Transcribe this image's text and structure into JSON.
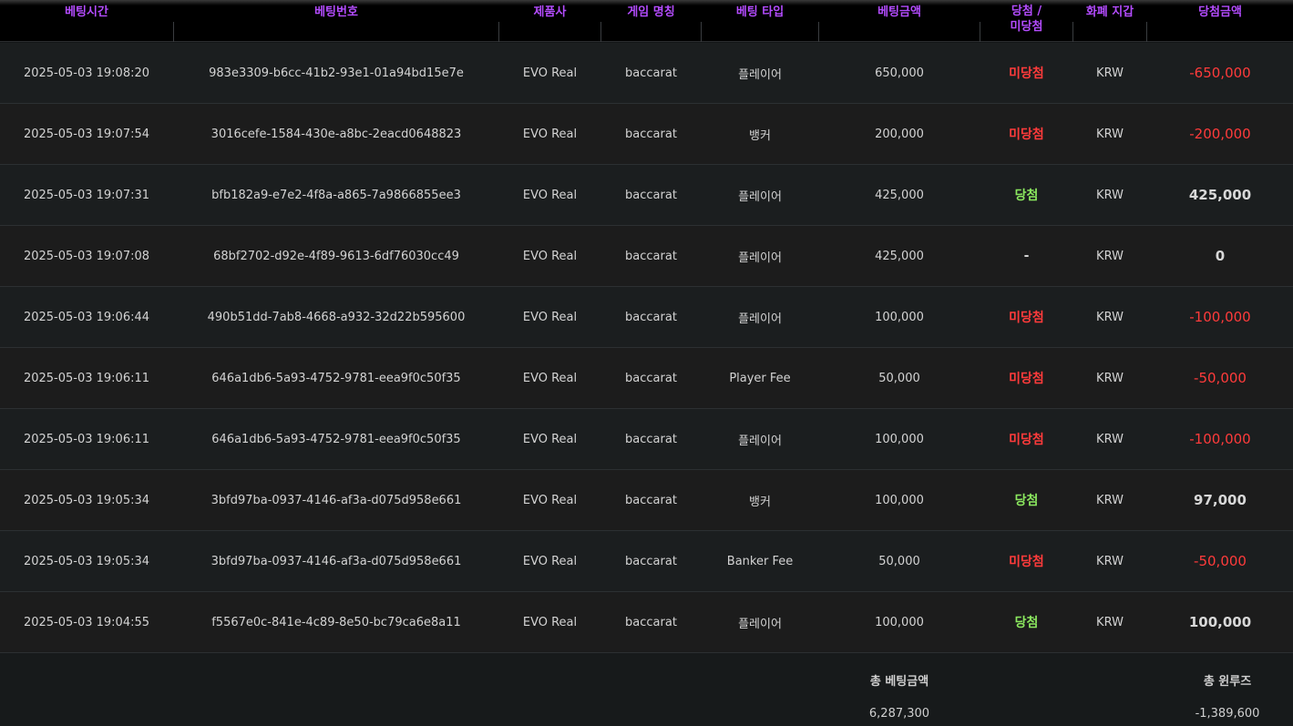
{
  "headers": {
    "time": "베팅시간",
    "bet_id": "베팅번호",
    "provider": "제품사",
    "game": "게임 명칭",
    "bet_type": "베팅 타입",
    "bet_amount": "베팅금액",
    "result_line1": "당첨 /",
    "result_line2": "미당첨",
    "currency": "화폐 지갑",
    "win_amount": "당첨금액"
  },
  "rows": [
    {
      "time": "2025-05-03 19:08:20",
      "bet_id": "983e3309-b6cc-41b2-93e1-01a94bd15e7e",
      "provider": "EVO Real",
      "game": "baccarat",
      "bet_type": "플레이어",
      "bet_amount": "650,000",
      "result": "미당첨",
      "result_kind": "lose",
      "currency": "KRW",
      "win_amount": "-650,000",
      "amount_kind": "lose"
    },
    {
      "time": "2025-05-03 19:07:54",
      "bet_id": "3016cefe-1584-430e-a8bc-2eacd0648823",
      "provider": "EVO Real",
      "game": "baccarat",
      "bet_type": "뱅커",
      "bet_amount": "200,000",
      "result": "미당첨",
      "result_kind": "lose",
      "currency": "KRW",
      "win_amount": "-200,000",
      "amount_kind": "lose"
    },
    {
      "time": "2025-05-03 19:07:31",
      "bet_id": "bfb182a9-e7e2-4f8a-a865-7a9866855ee3",
      "provider": "EVO Real",
      "game": "baccarat",
      "bet_type": "플레이어",
      "bet_amount": "425,000",
      "result": "당첨",
      "result_kind": "win",
      "currency": "KRW",
      "win_amount": "425,000",
      "amount_kind": "win"
    },
    {
      "time": "2025-05-03 19:07:08",
      "bet_id": "68bf2702-d92e-4f89-9613-6df76030cc49",
      "provider": "EVO Real",
      "game": "baccarat",
      "bet_type": "플레이어",
      "bet_amount": "425,000",
      "result": "-",
      "result_kind": "neutral",
      "currency": "KRW",
      "win_amount": "0",
      "amount_kind": "neutral"
    },
    {
      "time": "2025-05-03 19:06:44",
      "bet_id": "490b51dd-7ab8-4668-a932-32d22b595600",
      "provider": "EVO Real",
      "game": "baccarat",
      "bet_type": "플레이어",
      "bet_amount": "100,000",
      "result": "미당첨",
      "result_kind": "lose",
      "currency": "KRW",
      "win_amount": "-100,000",
      "amount_kind": "lose"
    },
    {
      "time": "2025-05-03 19:06:11",
      "bet_id": "646a1db6-5a93-4752-9781-eea9f0c50f35",
      "provider": "EVO Real",
      "game": "baccarat",
      "bet_type": "Player Fee",
      "bet_amount": "50,000",
      "result": "미당첨",
      "result_kind": "lose",
      "currency": "KRW",
      "win_amount": "-50,000",
      "amount_kind": "lose"
    },
    {
      "time": "2025-05-03 19:06:11",
      "bet_id": "646a1db6-5a93-4752-9781-eea9f0c50f35",
      "provider": "EVO Real",
      "game": "baccarat",
      "bet_type": "플레이어",
      "bet_amount": "100,000",
      "result": "미당첨",
      "result_kind": "lose",
      "currency": "KRW",
      "win_amount": "-100,000",
      "amount_kind": "lose"
    },
    {
      "time": "2025-05-03 19:05:34",
      "bet_id": "3bfd97ba-0937-4146-af3a-d075d958e661",
      "provider": "EVO Real",
      "game": "baccarat",
      "bet_type": "뱅커",
      "bet_amount": "100,000",
      "result": "당첨",
      "result_kind": "win",
      "currency": "KRW",
      "win_amount": "97,000",
      "amount_kind": "win"
    },
    {
      "time": "2025-05-03 19:05:34",
      "bet_id": "3bfd97ba-0937-4146-af3a-d075d958e661",
      "provider": "EVO Real",
      "game": "baccarat",
      "bet_type": "Banker Fee",
      "bet_amount": "50,000",
      "result": "미당첨",
      "result_kind": "lose",
      "currency": "KRW",
      "win_amount": "-50,000",
      "amount_kind": "lose"
    },
    {
      "time": "2025-05-03 19:04:55",
      "bet_id": "f5567e0c-841e-4c89-8e50-bc79ca6e8a11",
      "provider": "EVO Real",
      "game": "baccarat",
      "bet_type": "플레이어",
      "bet_amount": "100,000",
      "result": "당첨",
      "result_kind": "win",
      "currency": "KRW",
      "win_amount": "100,000",
      "amount_kind": "win"
    }
  ],
  "footer": {
    "total_bet_label": "총 베팅금액",
    "total_bet_value": "6,287,300",
    "total_winloss_label": "총 윈루즈",
    "total_winloss_value": "-1,389,600"
  },
  "colors": {
    "header_text": "#b44cff",
    "lose": "#ff3b3b",
    "win": "#8be85f"
  }
}
